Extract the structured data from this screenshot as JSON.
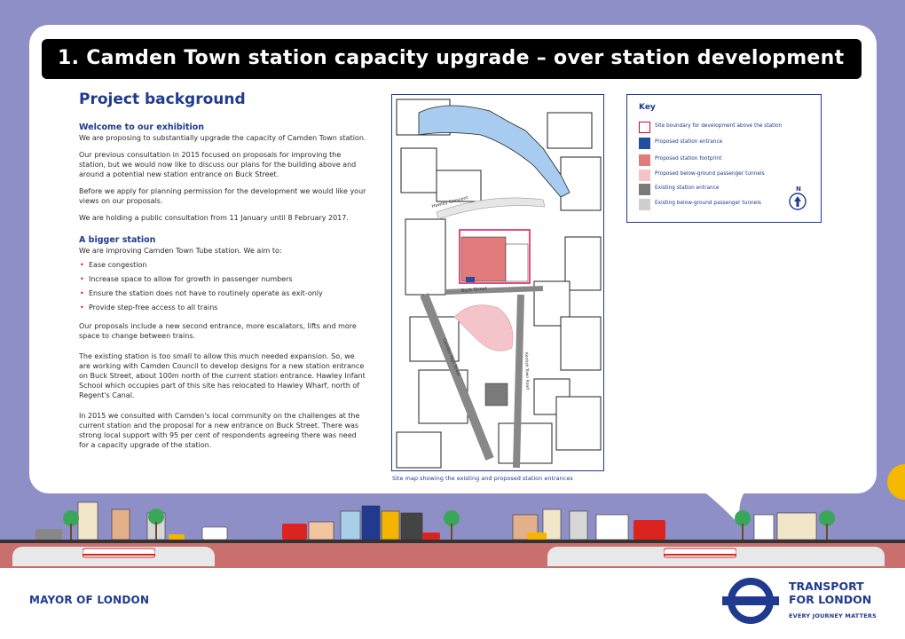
{
  "title": "1. Camden Town station capacity upgrade – over station development",
  "section_heading": "Project background",
  "welcome": {
    "heading": "Welcome to our exhibition",
    "paragraphs": [
      "We are proposing to substantially upgrade the capacity of Camden Town station.",
      "Our previous consultation in 2015 focused on proposals for improving the station, but we would now like to discuss our plans for the building above and around a potential new station entrance on Buck Street.",
      "Before we apply for planning permission for the development we would like your views on our proposals.",
      "We are holding a public consultation from 11 January until 8 February 2017."
    ]
  },
  "bigger": {
    "heading": "A bigger station",
    "intro": "We are improving Camden Town Tube station. We aim to:",
    "bullets": [
      "Ease congestion",
      "Increase space to allow for growth in passenger numbers",
      "Ensure the station does not have to routinely operate as exit-only",
      "Provide step-free access to all trains"
    ],
    "paragraphs": [
      "Our proposals include a new second entrance, more escalators, lifts and more space to change between trains.",
      "The existing station is too small to allow this much needed expansion. So, we are working with Camden Council to develop designs for a new station entrance on Buck Street, about 100m north of the current station entrance. Hawley Infant School which occupies part of this site has relocated to Hawley Wharf, north of Regent's Canal.",
      "In 2015 we consulted with Camden's local community on the challenges at the current station and the proposal for a new entrance on Buck Street. There was strong local support with 95 per cent of respondents agreeing there was need for a capacity upgrade of the station."
    ]
  },
  "map": {
    "caption": "Site map showing the existing and proposed station entrances",
    "street_labels": [
      "Hawley Crescent",
      "Buck Street",
      "Camden High Street",
      "Kentish Town Road"
    ]
  },
  "key": {
    "title": "Key",
    "north": "N",
    "items": [
      {
        "label": "Site boundary for development above the station",
        "color": "#e0003f",
        "style": "outline"
      },
      {
        "label": "Proposed station entrance",
        "color": "#1f4fa0",
        "style": "fill"
      },
      {
        "label": "Proposed station footprint",
        "color": "#e27b7b",
        "style": "fill"
      },
      {
        "label": "Proposed below-ground passenger tunnels",
        "color": "#f3c4c9",
        "style": "fill"
      },
      {
        "label": "Existing station entrance",
        "color": "#7a7a7a",
        "style": "fill"
      },
      {
        "label": "Existing below-ground passenger tunnels",
        "color": "#cfcfcf",
        "style": "fill"
      }
    ]
  },
  "footer": {
    "mayor": "MAYOR OF LONDON",
    "tfl_line1": "TRANSPORT",
    "tfl_line2": "FOR LONDON",
    "tfl_tagline": "EVERY JOURNEY MATTERS"
  },
  "colors": {
    "brand_blue": "#1f3a8f",
    "band_purple": "#8f8fc7",
    "tube_red": "#c9706f",
    "roundel_red": "#dc241f"
  }
}
